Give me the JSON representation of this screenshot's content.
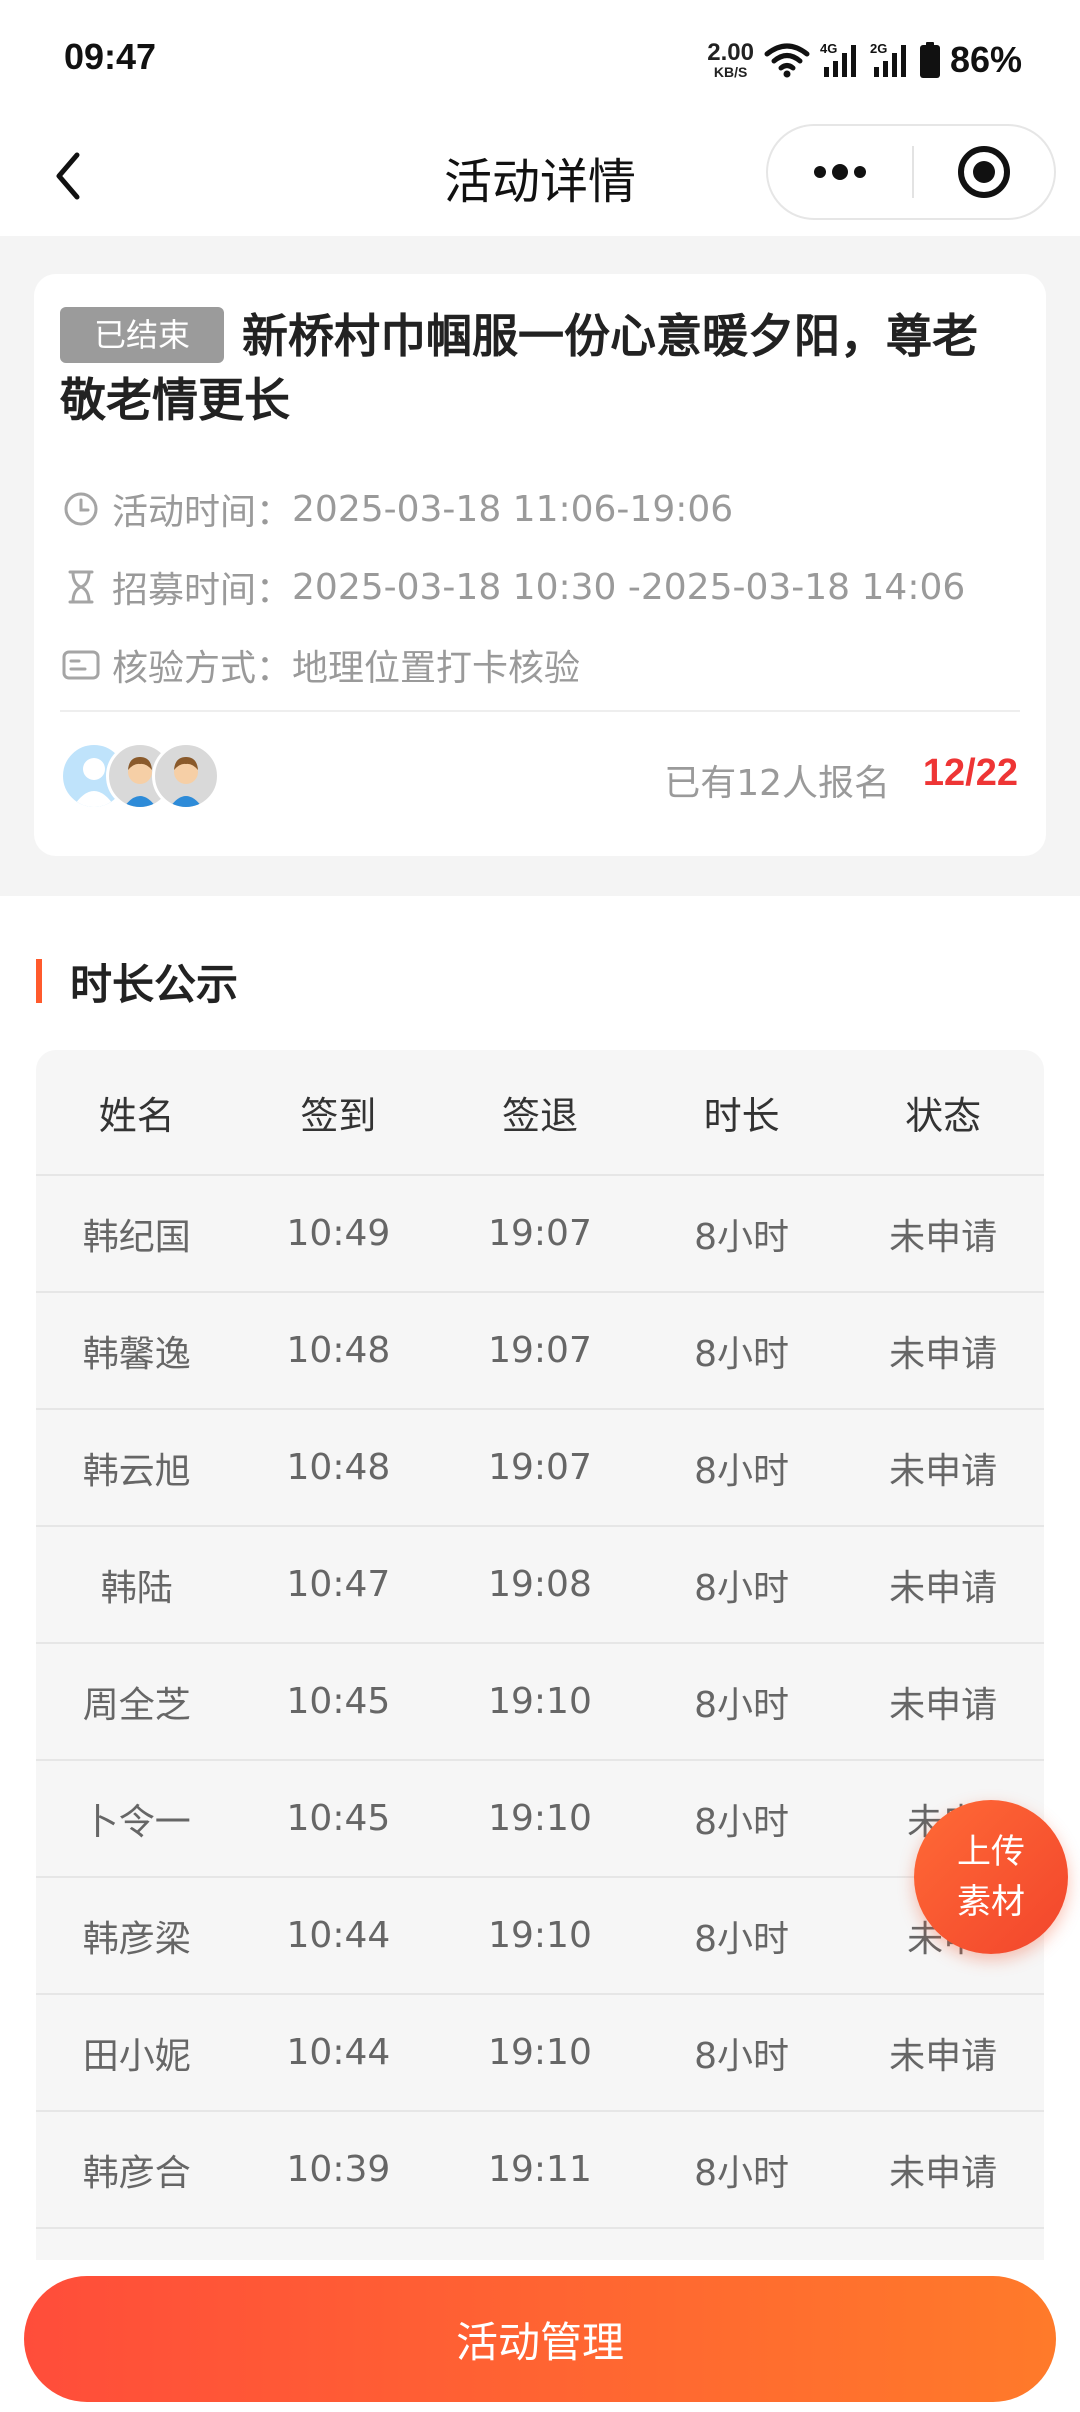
{
  "status_bar": {
    "time": "09:47",
    "net_speed_value": "2.00",
    "net_speed_unit": "KB/S",
    "signal1_label": "4G",
    "signal2_label": "2G",
    "battery": "86%"
  },
  "nav": {
    "title": "活动详情",
    "back_icon": "chevron-left-icon",
    "more_icon": "more-dots-icon",
    "close_icon": "target-circle-icon"
  },
  "activity": {
    "badge": "已结束",
    "title": "新桥村巾帼服一份心意暖夕阳，尊老敬老情更长",
    "rows": [
      {
        "icon": "clock-icon",
        "label": "活动时间：",
        "value": "2025-03-18 11:06-19:06"
      },
      {
        "icon": "hourglass-icon",
        "label": "招募时间：",
        "value": "2025-03-18 10:30 -2025-03-18 14:06"
      },
      {
        "icon": "id-card-icon",
        "label": "核验方式：",
        "value": "地理位置打卡核验"
      }
    ],
    "signup_text": "已有12人报名",
    "signup_count": "12/22"
  },
  "section": {
    "title": "时长公示"
  },
  "table": {
    "headers": [
      "姓名",
      "签到",
      "签退",
      "时长",
      "状态"
    ],
    "rows": [
      [
        "韩纪国",
        "10:49",
        "19:07",
        "8小时",
        "未申请"
      ],
      [
        "韩馨逸",
        "10:48",
        "19:07",
        "8小时",
        "未申请"
      ],
      [
        "韩云旭",
        "10:48",
        "19:07",
        "8小时",
        "未申请"
      ],
      [
        "韩陆",
        "10:47",
        "19:08",
        "8小时",
        "未申请"
      ],
      [
        "周全芝",
        "10:45",
        "19:10",
        "8小时",
        "未申请"
      ],
      [
        "卜令一",
        "10:45",
        "19:10",
        "8小时",
        "未申"
      ],
      [
        "韩彦梁",
        "10:44",
        "19:10",
        "8小时",
        "未申"
      ],
      [
        "田小妮",
        "10:44",
        "19:10",
        "8小时",
        "未申请"
      ],
      [
        "韩彦合",
        "10:39",
        "19:11",
        "8小时",
        "未申请"
      ]
    ]
  },
  "fab": {
    "line1": "上传",
    "line2": "素材"
  },
  "bottom_button": {
    "label": "活动管理"
  },
  "colors": {
    "accent": "#ff5a2c",
    "count_red": "#ee3535",
    "badge_grey": "#9b9b9b"
  }
}
